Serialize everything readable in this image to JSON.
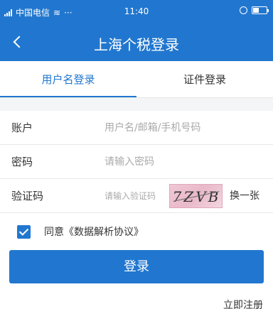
{
  "status_bar": {
    "carrier": "中国电信",
    "dots": "···",
    "time": "11:40"
  },
  "nav": {
    "title": "上海个税登录"
  },
  "tabs": [
    {
      "label": "用户名登录",
      "active": true
    },
    {
      "label": "证件登录",
      "active": false
    }
  ],
  "form": {
    "account": {
      "label": "账户",
      "placeholder": "用户名/邮箱/手机号码"
    },
    "password": {
      "label": "密码",
      "placeholder": "请输入密码"
    },
    "captcha": {
      "label": "验证码",
      "placeholder": "请输入验证码",
      "captcha_text": "7ZVB",
      "refresh_label": "换一张"
    }
  },
  "agreement": {
    "checked": true,
    "text": "同意《数据解析协议》"
  },
  "login_button": "登录",
  "register_link": "立即注册",
  "colors": {
    "primary": "#2177cf",
    "background": "#f4f5f7"
  }
}
